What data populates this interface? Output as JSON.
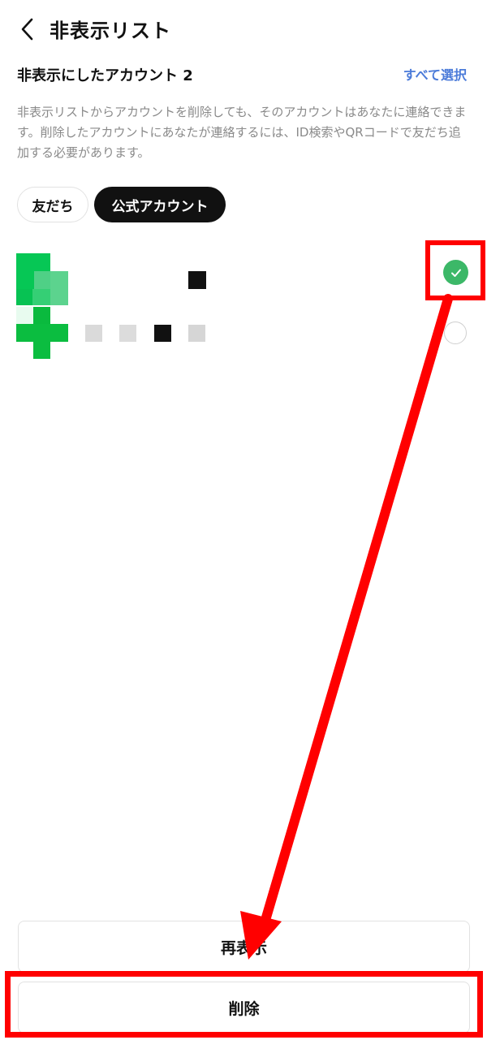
{
  "header": {
    "title": "非表示リスト"
  },
  "section": {
    "title": "非表示にしたアカウント 2",
    "select_all": "すべて選択"
  },
  "notice": "非表示リストからアカウントを削除しても、そのアカウントはあなたに連絡できます。削除したアカウントにあなたが連絡するには、ID検索やQRコードで友だち追加する必要があります。",
  "tabs": [
    {
      "label": "友だち",
      "selected": false
    },
    {
      "label": "公式アカウント",
      "selected": true
    }
  ],
  "accounts": [
    {
      "name_state": "pixelated",
      "checked": true
    },
    {
      "name_state": "pixelated",
      "checked": false
    }
  ],
  "buttons": {
    "redisplay": "再表示",
    "delete": "削除"
  },
  "colors": {
    "accent": "#4b7bd9",
    "check": "#3cb868",
    "highlight": "#ff0000",
    "line_green": "#06c755"
  }
}
